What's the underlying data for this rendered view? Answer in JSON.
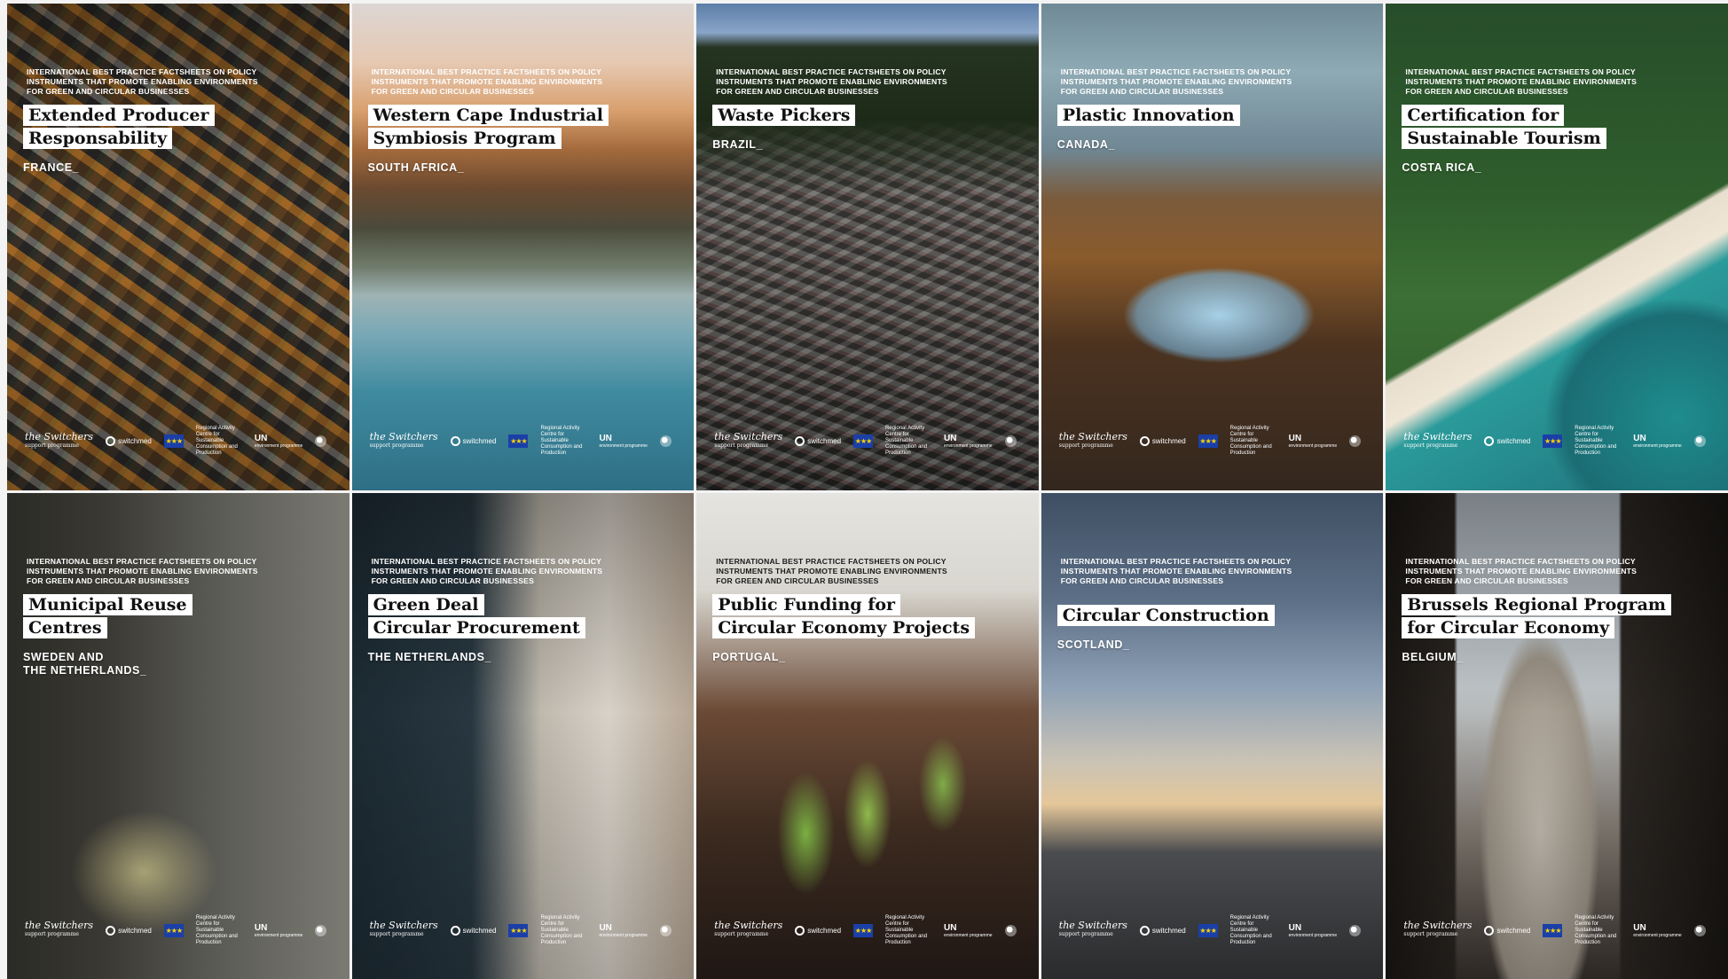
{
  "header_lines": [
    "INTERNATIONAL BEST PRACTICE FACTSHEETS ON POLICY",
    "INSTRUMENTS THAT PROMOTE ENABLING ENVIRONMENTS",
    "FOR GREEN AND CIRCULAR BUSINESSES"
  ],
  "footer": {
    "switchers": "the Switchers",
    "switchers_sub": "support programme",
    "switchmed": "switchmed",
    "eu_flag_stars": "★★★",
    "rc": "Regional Activity Centre for Sustainable Consumption and Production",
    "un": "UN",
    "un_sub": "environment programme"
  },
  "cards": [
    {
      "title_lines": [
        "Extended Producer",
        "Responsability"
      ],
      "country": "FRANCE_",
      "image": "batteries"
    },
    {
      "title_lines": [
        "Western Cape Industrial",
        "Symbiosis Program"
      ],
      "country": "SOUTH AFRICA_",
      "image": "coastline"
    },
    {
      "title_lines": [
        "Waste Pickers"
      ],
      "country": "BRAZIL_",
      "image": "landfill"
    },
    {
      "title_lines": [
        "Plastic Innovation"
      ],
      "country": "CANADA_",
      "image": "plastic-bottle"
    },
    {
      "title_lines": [
        "Certification for",
        "Sustainable Tourism"
      ],
      "country": "COSTA RICA_",
      "image": "beach"
    },
    {
      "title_lines": [
        "Municipal Reuse",
        "Centres"
      ],
      "country": "SWEDEN AND\nTHE NETHERLANDS_",
      "image": "vintage-items"
    },
    {
      "title_lines": [
        "Green Deal",
        "Circular Procurement"
      ],
      "country": "THE NETHERLANDS_",
      "image": "handshake"
    },
    {
      "title_lines": [
        "Public Funding for",
        "Circular Economy Projects"
      ],
      "country": "PORTUGAL_",
      "image": "sprouts"
    },
    {
      "title_lines": [
        "Circular Construction"
      ],
      "country": "SCOTLAND_",
      "image": "sunset-pier"
    },
    {
      "title_lines": [
        "Brussels Regional Program",
        "for Circular Economy"
      ],
      "country": "BELGIUM_",
      "image": "brussels-street"
    }
  ]
}
